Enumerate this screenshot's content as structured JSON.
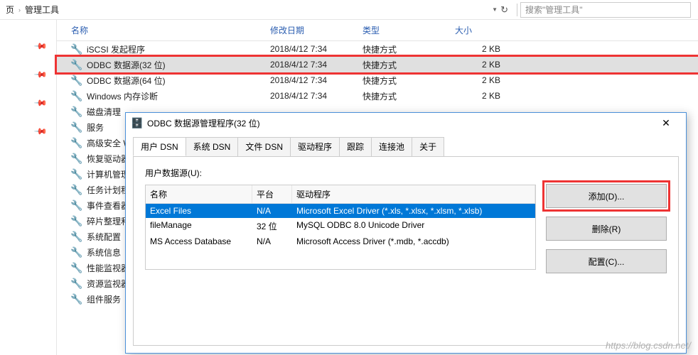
{
  "breadcrumb": {
    "part1": "页",
    "sep": "›",
    "part2": "管理工具"
  },
  "search": {
    "placeholder": "搜索\"管理工具\""
  },
  "columns": {
    "name": "名称",
    "modified": "修改日期",
    "type": "类型",
    "size": "大小"
  },
  "files": [
    {
      "icon": "shortcut-icon",
      "name": "iSCSI 发起程序",
      "date": "2018/4/12 7:34",
      "type": "快捷方式",
      "size": "2 KB",
      "red": false
    },
    {
      "icon": "shortcut-icon",
      "name": "ODBC 数据源(32 位)",
      "date": "2018/4/12 7:34",
      "type": "快捷方式",
      "size": "2 KB",
      "red": true
    },
    {
      "icon": "shortcut-icon",
      "name": "ODBC 数据源(64 位)",
      "date": "2018/4/12 7:34",
      "type": "快捷方式",
      "size": "2 KB",
      "red": false
    },
    {
      "icon": "shortcut-icon",
      "name": "Windows 内存诊断",
      "date": "2018/4/12 7:34",
      "type": "快捷方式",
      "size": "2 KB",
      "red": false
    },
    {
      "icon": "shortcut-icon",
      "name": "磁盘清理",
      "date": "",
      "type": "",
      "size": "",
      "red": false
    },
    {
      "icon": "shortcut-icon",
      "name": "服务",
      "date": "",
      "type": "",
      "size": "",
      "red": false
    },
    {
      "icon": "shortcut-icon",
      "name": "高级安全 Windows",
      "date": "",
      "type": "",
      "size": "",
      "red": false
    },
    {
      "icon": "shortcut-icon",
      "name": "恢复驱动器",
      "date": "",
      "type": "",
      "size": "",
      "red": false
    },
    {
      "icon": "shortcut-icon",
      "name": "计算机管理",
      "date": "",
      "type": "",
      "size": "",
      "red": false
    },
    {
      "icon": "shortcut-icon",
      "name": "任务计划程序",
      "date": "",
      "type": "",
      "size": "",
      "red": false
    },
    {
      "icon": "shortcut-icon",
      "name": "事件查看器",
      "date": "",
      "type": "",
      "size": "",
      "red": false
    },
    {
      "icon": "shortcut-icon",
      "name": "碎片整理和优化",
      "date": "",
      "type": "",
      "size": "",
      "red": false
    },
    {
      "icon": "shortcut-icon",
      "name": "系统配置",
      "date": "",
      "type": "",
      "size": "",
      "red": false
    },
    {
      "icon": "shortcut-icon",
      "name": "系统信息",
      "date": "",
      "type": "",
      "size": "",
      "red": false
    },
    {
      "icon": "shortcut-icon",
      "name": "性能监视器",
      "date": "",
      "type": "",
      "size": "",
      "red": false
    },
    {
      "icon": "shortcut-icon",
      "name": "资源监视器",
      "date": "",
      "type": "",
      "size": "",
      "red": false
    },
    {
      "icon": "shortcut-icon",
      "name": "组件服务",
      "date": "",
      "type": "",
      "size": "",
      "red": false
    }
  ],
  "dialog": {
    "title": "ODBC 数据源管理程序(32 位)",
    "tabs": [
      "用户 DSN",
      "系统 DSN",
      "文件 DSN",
      "驱动程序",
      "跟踪",
      "连接池",
      "关于"
    ],
    "active_tab": 0,
    "section_label": "用户数据源(U):",
    "table": {
      "head": {
        "name": "名称",
        "platform": "平台",
        "driver": "驱动程序"
      },
      "rows": [
        {
          "name": "Excel Files",
          "platform": "N/A",
          "driver": "Microsoft Excel Driver (*.xls, *.xlsx, *.xlsm, *.xlsb)",
          "selected": true
        },
        {
          "name": "fileManage",
          "platform": "32 位",
          "driver": "MySQL ODBC 8.0 Unicode Driver",
          "selected": false
        },
        {
          "name": "MS Access Database",
          "platform": "N/A",
          "driver": "Microsoft Access Driver (*.mdb, *.accdb)",
          "selected": false
        }
      ]
    },
    "buttons": {
      "add": "添加(D)...",
      "remove": "删除(R)",
      "configure": "配置(C)..."
    }
  },
  "watermark": "https://blog.csdn.net/"
}
